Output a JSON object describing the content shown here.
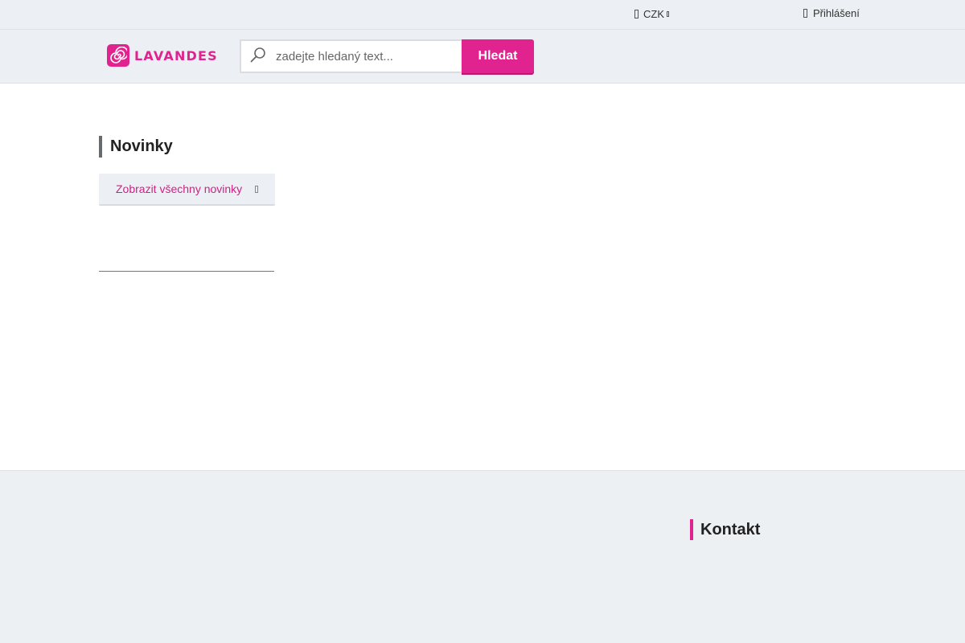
{
  "topbar": {
    "currency": "CZK",
    "login_label": "Přihlášení"
  },
  "header": {
    "logo_text": "LAVANDES",
    "search": {
      "placeholder": "zadejte hledaný text...",
      "value": "",
      "button_label": "Hledat"
    }
  },
  "main": {
    "section_title": "Novinky",
    "show_all_label": "Zobrazit všechny novinky"
  },
  "footer": {
    "contact_title": "Kontakt"
  },
  "colors": {
    "brand": "#e0238f",
    "bar_background": "#eceff3"
  },
  "icons": {
    "currency": "wallet-icon",
    "currency_dropdown": "chevron-down-icon",
    "login": "user-icon",
    "search": "search-icon",
    "show_all_arrow": "chevron-right-icon"
  }
}
